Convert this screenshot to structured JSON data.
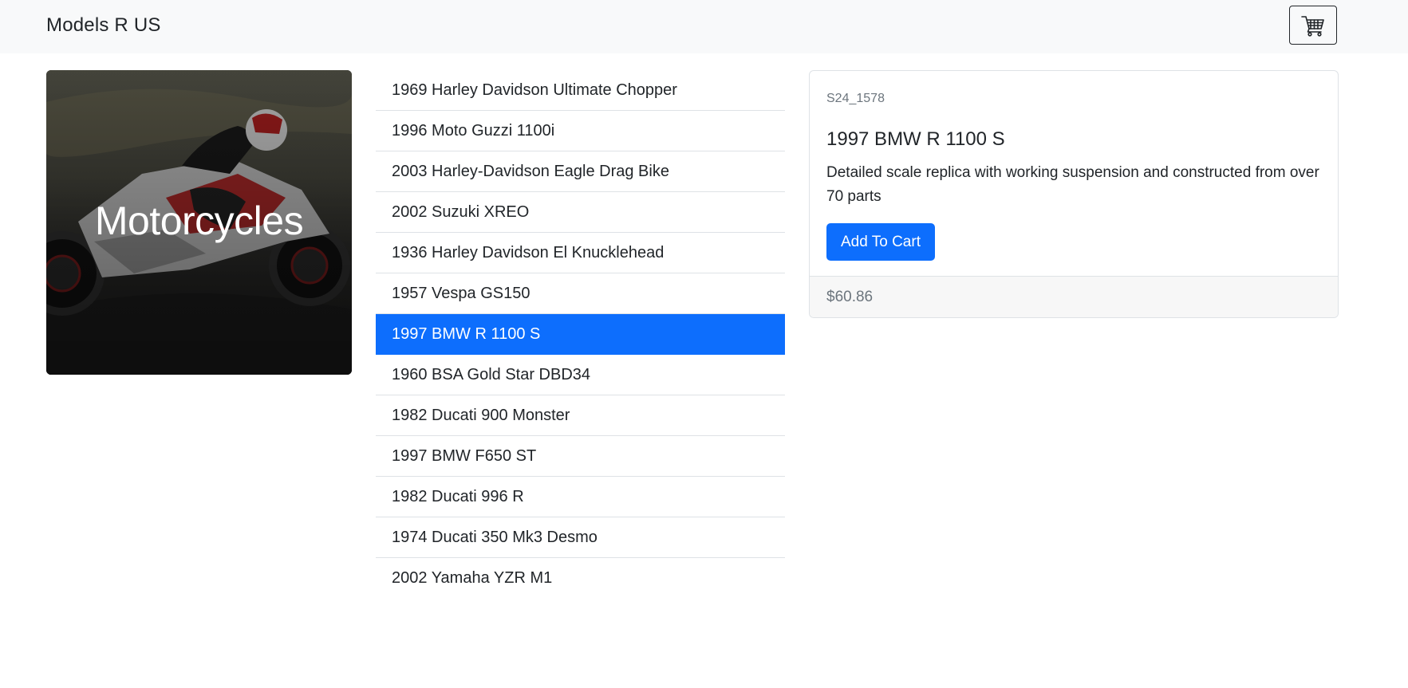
{
  "brand": "Models R US",
  "cart": {
    "icon": "shopping-cart-icon"
  },
  "category": {
    "title": "Motorcycles",
    "image": "motorcycle-photo"
  },
  "products": [
    "1969 Harley Davidson Ultimate Chopper",
    "1996 Moto Guzzi 1100i",
    "2003 Harley-Davidson Eagle Drag Bike",
    "2002 Suzuki XREO",
    "1936 Harley Davidson El Knucklehead",
    "1957 Vespa GS150",
    "1997 BMW R 1100 S",
    "1960 BSA Gold Star DBD34",
    "1982 Ducati 900 Monster",
    "1997 BMW F650 ST",
    "1982 Ducati 996 R",
    "1974 Ducati 350 Mk3 Desmo",
    "2002 Yamaha YZR M1"
  ],
  "selected_index": 6,
  "detail": {
    "sku": "S24_1578",
    "title": "1997 BMW R 1100 S",
    "description": "Detailed scale replica with working suspension and constructed from over 70 parts",
    "add_to_cart_label": "Add To Cart",
    "price": "$60.86"
  },
  "colors": {
    "primary": "#0d6efd",
    "navbar_bg": "#f8f9fa",
    "muted_text": "#6c757d",
    "border": "#dee2e6"
  }
}
